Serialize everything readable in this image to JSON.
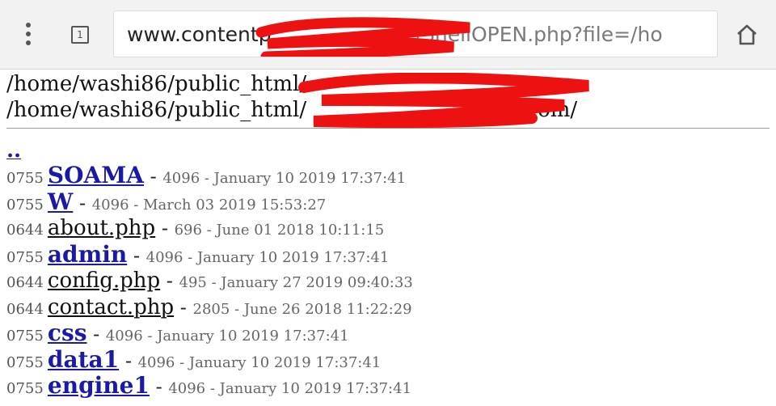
{
  "browser": {
    "tabs_count": "1",
    "url_host": "www.contentp",
    "url_path": "/ShellOPEN.php?file=/ho"
  },
  "paths": {
    "line1": "/home/washi86/public_html/",
    "line2": "/home/washi86/public_html/",
    "line2_suffix": "om/"
  },
  "parent_link": "..",
  "columns": [
    "permissions",
    "name",
    "size",
    "modified"
  ],
  "entries": [
    {
      "perm": "0755",
      "name": "SOAMA",
      "type": "dir",
      "meta": "4096 - January 10 2019 17:37:41"
    },
    {
      "perm": "0755",
      "name": "W",
      "type": "dir",
      "meta": "4096 - March 03 2019 15:53:27"
    },
    {
      "perm": "0644",
      "name": "about.php",
      "type": "file",
      "meta": "696 - June 01 2018 10:11:15"
    },
    {
      "perm": "0755",
      "name": "admin",
      "type": "dir",
      "meta": "4096 - January 10 2019 17:37:41"
    },
    {
      "perm": "0644",
      "name": "config.php",
      "type": "file",
      "meta": "495 - January 27 2019 09:40:33"
    },
    {
      "perm": "0644",
      "name": "contact.php",
      "type": "file",
      "meta": "2805 - June 26 2018 11:22:29"
    },
    {
      "perm": "0755",
      "name": "css",
      "type": "dir",
      "meta": "4096 - January 10 2019 17:37:41"
    },
    {
      "perm": "0755",
      "name": "data1",
      "type": "dir",
      "meta": "4096 - January 10 2019 17:37:41"
    },
    {
      "perm": "0755",
      "name": "engine1",
      "type": "dir",
      "meta": "4096 - January 10 2019 17:37:41"
    }
  ],
  "colors": {
    "redaction": "#ee1111",
    "link": "#1a1aa6"
  },
  "icons": {
    "menu": "more-vert-icon",
    "tabs": "tab-switcher-icon",
    "home": "home-icon"
  }
}
